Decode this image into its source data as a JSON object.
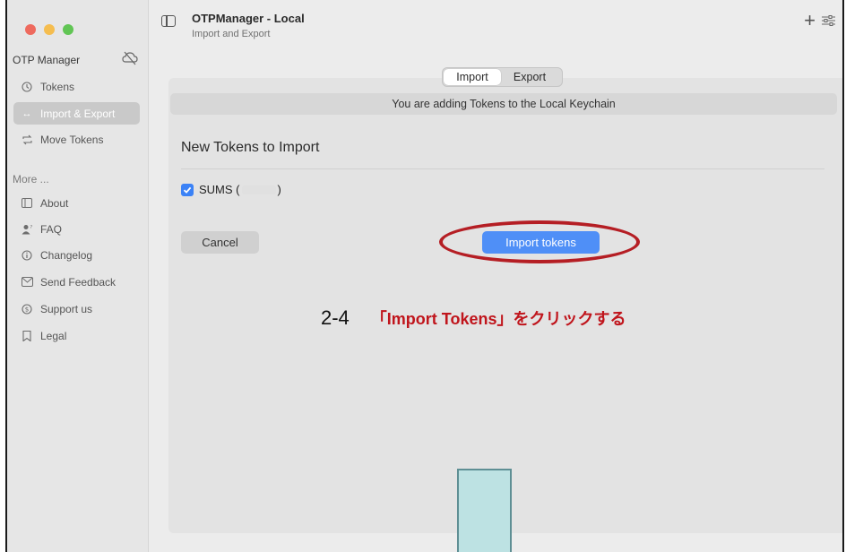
{
  "window": {
    "title": "OTPManager - Local",
    "subtitle": "Import and Export",
    "add_icon": "plus-icon",
    "settings_icon": "sliders-icon"
  },
  "sidebar": {
    "title": "OTP Manager",
    "cloud_icon": "cloud-off-icon",
    "items": [
      {
        "label": "Tokens",
        "icon": "clock-icon"
      },
      {
        "label": "Import & Export",
        "icon": "arrows-icon",
        "selected": true
      },
      {
        "label": "Move Tokens",
        "icon": "move-icon"
      }
    ],
    "more_label": "More ...",
    "more_items": [
      {
        "label": "About",
        "icon": "sidebar-icon"
      },
      {
        "label": "FAQ",
        "icon": "person-question-icon"
      },
      {
        "label": "Changelog",
        "icon": "info-icon"
      },
      {
        "label": "Send Feedback",
        "icon": "mail-icon"
      },
      {
        "label": "Support us",
        "icon": "dollar-icon"
      },
      {
        "label": "Legal",
        "icon": "bookmark-icon"
      }
    ]
  },
  "segmented": {
    "import_label": "Import",
    "export_label": "Export",
    "selected": "Import"
  },
  "notice": "You are adding Tokens to the Local Keychain",
  "section": {
    "heading": "New Tokens to Import",
    "token_label_prefix": "SUMS (",
    "token_label_suffix": ")",
    "checked": true
  },
  "buttons": {
    "cancel": "Cancel",
    "import": "Import tokens"
  },
  "annotation": {
    "step": "2-4",
    "text": "「Import Tokens」をクリックする",
    "color": "#c0151c"
  },
  "colors": {
    "accent": "#4f8ff7",
    "highlight_ring": "#b51e24"
  }
}
